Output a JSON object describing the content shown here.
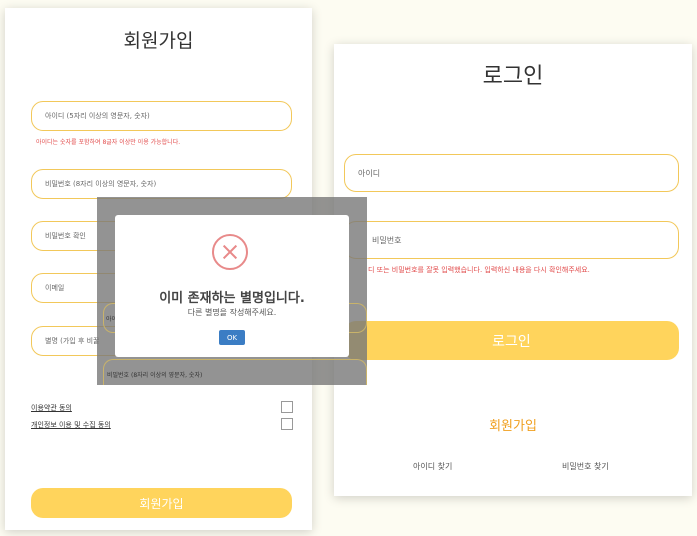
{
  "signup": {
    "title": "회원가입",
    "id_placeholder": "아이디 (5자리 이상의 영문자, 숫자)",
    "id_error": "아이디는 숫자를 포함하여 8글자 이상만 이용 가능합니다.",
    "password_placeholder": "비밀번호 (8자리 이상의 영문자, 숫자)",
    "password_confirm_placeholder": "비밀번호 확인",
    "email_placeholder": "이메일",
    "nickname_placeholder": "별명 (가입 후 비꿀",
    "terms_label": "이용약관 동의",
    "privacy_label": "개인정보 이용 및 수집 동의",
    "submit_label": "회원가입"
  },
  "login": {
    "title": "로그인",
    "id_placeholder": "아이디",
    "password_placeholder": "비밀번호",
    "error": "디 또는 비밀번호를 잘못 입력했습니다. 입력하신 내용을 다시 확인해주세요.",
    "submit_label": "로그인",
    "signup_link": "회원가입",
    "find_id_link": "아이디 찾기",
    "find_password_link": "비밀번호 찾기"
  },
  "overlay": {
    "field_left_label": "아이",
    "field_bottom_label": "비밀번호 (8자리 이상의 영문자, 숫자)"
  },
  "modal": {
    "icon": "error-x-icon",
    "title": "이미 존재하는 별명입니다.",
    "message": "다른 별명을 작성해주세요.",
    "ok_label": "OK"
  },
  "colors": {
    "accent_yellow": "#ffd45c",
    "field_border": "#f2c85a",
    "error_red": "#e24c4c",
    "ok_blue": "#3b7dc4",
    "link_orange": "#f0a020"
  }
}
